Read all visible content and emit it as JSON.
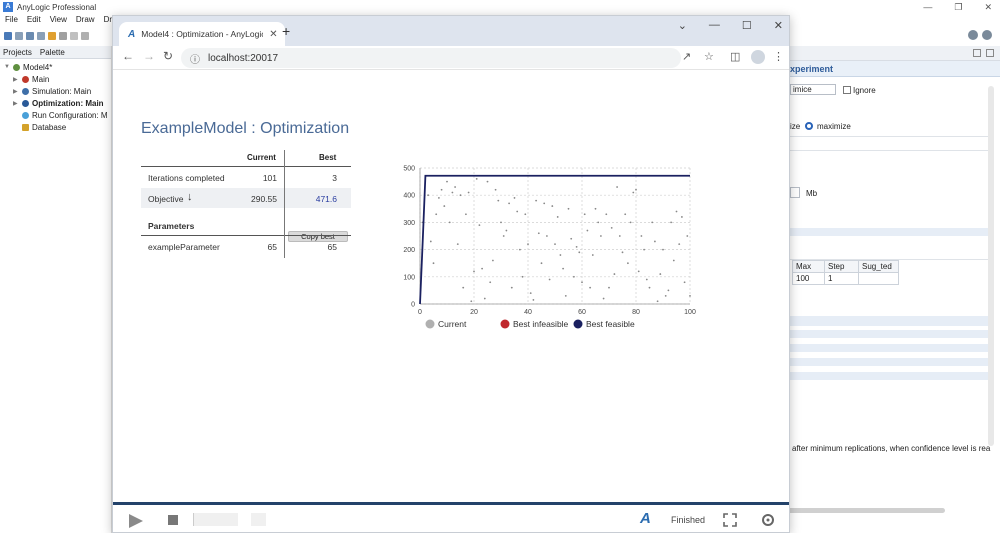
{
  "ide": {
    "title": "AnyLogic Professional",
    "menu": [
      "File",
      "Edit",
      "View",
      "Draw",
      "Dr"
    ],
    "panel_tabs": [
      "Projects",
      "Palette"
    ],
    "tree": [
      {
        "label": "Model4*",
        "level": 0,
        "color": "#5f8f3f"
      },
      {
        "label": "Main",
        "level": 1,
        "color": "#c0392b"
      },
      {
        "label": "Simulation: Main",
        "level": 1,
        "color": "#3f6fa8"
      },
      {
        "label": "Optimization: Main",
        "level": 1,
        "color": "#2a5a98",
        "bold": true
      },
      {
        "label": "Run Configuration: M",
        "level": 1,
        "color": "#4aa0d8"
      },
      {
        "label": "Database",
        "level": 1,
        "color": "#d4a22a"
      }
    ],
    "properties": {
      "header": "xperiment",
      "objective_value": "imice",
      "ignore_label": "Ignore",
      "minimize_partial": "ize",
      "maximize_label": "maximize",
      "mb_label": "Mb",
      "table_headers": [
        "Max",
        "Step",
        "Sug_ted"
      ],
      "table_row": [
        "100",
        "1",
        ""
      ],
      "footer_text": "after minimum replications, when confidence level is rea"
    }
  },
  "browser": {
    "tab_title": "Model4 : Optimization - AnyLogic",
    "url": "localhost:20017"
  },
  "page": {
    "title": "ExampleModel : Optimization",
    "col_current": "Current",
    "col_best": "Best",
    "iterations_label": "Iterations completed",
    "iterations_current": "101",
    "iterations_best": "3",
    "objective_label": "Objective",
    "objective_current": "290.55",
    "objective_best": "471.6",
    "parameters_label": "Parameters",
    "copy_best_label": "Copy best",
    "param_name": "exampleParameter",
    "param_current": "65",
    "param_best": "65"
  },
  "chart_data": {
    "type": "scatter",
    "xlim": [
      0,
      100
    ],
    "ylim": [
      0,
      500
    ],
    "xticks": [
      0,
      20,
      40,
      60,
      80,
      100
    ],
    "yticks": [
      0,
      100,
      200,
      300,
      400,
      500
    ],
    "grid": true,
    "legend_position": "bottom",
    "colors": {
      "current": "#b0b0b0",
      "infeasible": "#c0282d",
      "feasible": "#1a2060"
    },
    "legend": [
      "Current",
      "Best infeasible",
      "Best feasible"
    ],
    "best_feasible_line": [
      [
        0,
        0
      ],
      [
        1,
        230
      ],
      [
        2,
        471.6
      ],
      [
        100,
        471.6
      ]
    ],
    "current_points": [
      [
        1,
        300
      ],
      [
        2,
        470
      ],
      [
        3,
        400
      ],
      [
        4,
        230
      ],
      [
        5,
        150
      ],
      [
        6,
        330
      ],
      [
        7,
        390
      ],
      [
        8,
        420
      ],
      [
        9,
        360
      ],
      [
        10,
        450
      ],
      [
        11,
        300
      ],
      [
        12,
        410
      ],
      [
        13,
        430
      ],
      [
        14,
        220
      ],
      [
        15,
        400
      ],
      [
        16,
        60
      ],
      [
        17,
        330
      ],
      [
        18,
        410
      ],
      [
        19,
        10
      ],
      [
        20,
        120
      ],
      [
        21,
        460
      ],
      [
        22,
        290
      ],
      [
        23,
        130
      ],
      [
        24,
        20
      ],
      [
        25,
        450
      ],
      [
        26,
        80
      ],
      [
        27,
        160
      ],
      [
        28,
        420
      ],
      [
        29,
        380
      ],
      [
        30,
        300
      ],
      [
        31,
        250
      ],
      [
        32,
        270
      ],
      [
        33,
        370
      ],
      [
        34,
        60
      ],
      [
        35,
        390
      ],
      [
        36,
        340
      ],
      [
        37,
        200
      ],
      [
        38,
        100
      ],
      [
        39,
        330
      ],
      [
        40,
        220
      ],
      [
        41,
        40
      ],
      [
        42,
        15
      ],
      [
        43,
        380
      ],
      [
        44,
        260
      ],
      [
        45,
        150
      ],
      [
        46,
        370
      ],
      [
        47,
        250
      ],
      [
        48,
        90
      ],
      [
        49,
        360
      ],
      [
        50,
        220
      ],
      [
        51,
        320
      ],
      [
        52,
        180
      ],
      [
        53,
        130
      ],
      [
        54,
        30
      ],
      [
        55,
        350
      ],
      [
        56,
        240
      ],
      [
        57,
        100
      ],
      [
        58,
        210
      ],
      [
        59,
        190
      ],
      [
        60,
        80
      ],
      [
        61,
        330
      ],
      [
        62,
        270
      ],
      [
        63,
        60
      ],
      [
        64,
        180
      ],
      [
        65,
        350
      ],
      [
        66,
        300
      ],
      [
        67,
        250
      ],
      [
        68,
        20
      ],
      [
        69,
        330
      ],
      [
        70,
        60
      ],
      [
        71,
        280
      ],
      [
        72,
        110
      ],
      [
        73,
        430
      ],
      [
        74,
        250
      ],
      [
        75,
        190
      ],
      [
        76,
        330
      ],
      [
        77,
        150
      ],
      [
        78,
        300
      ],
      [
        79,
        410
      ],
      [
        80,
        420
      ],
      [
        81,
        120
      ],
      [
        82,
        250
      ],
      [
        83,
        200
      ],
      [
        84,
        90
      ],
      [
        85,
        60
      ],
      [
        86,
        300
      ],
      [
        87,
        230
      ],
      [
        88,
        10
      ],
      [
        89,
        110
      ],
      [
        90,
        200
      ],
      [
        91,
        30
      ],
      [
        92,
        50
      ],
      [
        93,
        300
      ],
      [
        94,
        160
      ],
      [
        95,
        340
      ],
      [
        96,
        220
      ],
      [
        97,
        320
      ],
      [
        98,
        80
      ],
      [
        99,
        250
      ],
      [
        100,
        30
      ]
    ]
  },
  "bottom_bar": {
    "status": "Finished"
  }
}
